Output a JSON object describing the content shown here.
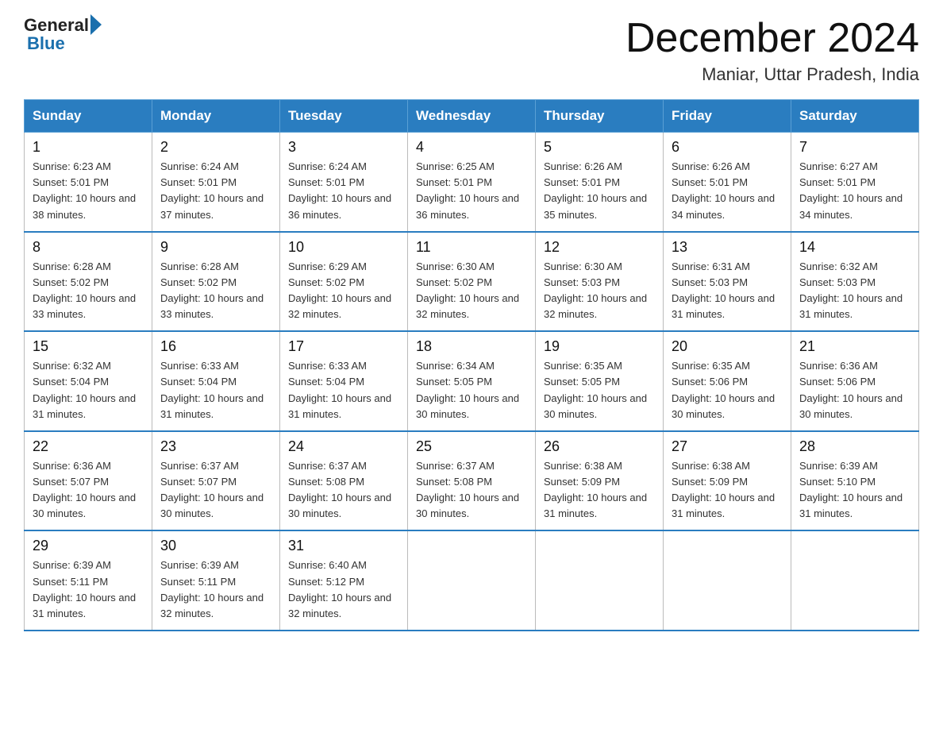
{
  "logo": {
    "text_general": "General",
    "text_blue": "Blue"
  },
  "title": "December 2024",
  "subtitle": "Maniar, Uttar Pradesh, India",
  "days_of_week": [
    "Sunday",
    "Monday",
    "Tuesday",
    "Wednesday",
    "Thursday",
    "Friday",
    "Saturday"
  ],
  "weeks": [
    [
      {
        "day": "1",
        "sunrise": "6:23 AM",
        "sunset": "5:01 PM",
        "daylight": "10 hours and 38 minutes."
      },
      {
        "day": "2",
        "sunrise": "6:24 AM",
        "sunset": "5:01 PM",
        "daylight": "10 hours and 37 minutes."
      },
      {
        "day": "3",
        "sunrise": "6:24 AM",
        "sunset": "5:01 PM",
        "daylight": "10 hours and 36 minutes."
      },
      {
        "day": "4",
        "sunrise": "6:25 AM",
        "sunset": "5:01 PM",
        "daylight": "10 hours and 36 minutes."
      },
      {
        "day": "5",
        "sunrise": "6:26 AM",
        "sunset": "5:01 PM",
        "daylight": "10 hours and 35 minutes."
      },
      {
        "day": "6",
        "sunrise": "6:26 AM",
        "sunset": "5:01 PM",
        "daylight": "10 hours and 34 minutes."
      },
      {
        "day": "7",
        "sunrise": "6:27 AM",
        "sunset": "5:01 PM",
        "daylight": "10 hours and 34 minutes."
      }
    ],
    [
      {
        "day": "8",
        "sunrise": "6:28 AM",
        "sunset": "5:02 PM",
        "daylight": "10 hours and 33 minutes."
      },
      {
        "day": "9",
        "sunrise": "6:28 AM",
        "sunset": "5:02 PM",
        "daylight": "10 hours and 33 minutes."
      },
      {
        "day": "10",
        "sunrise": "6:29 AM",
        "sunset": "5:02 PM",
        "daylight": "10 hours and 32 minutes."
      },
      {
        "day": "11",
        "sunrise": "6:30 AM",
        "sunset": "5:02 PM",
        "daylight": "10 hours and 32 minutes."
      },
      {
        "day": "12",
        "sunrise": "6:30 AM",
        "sunset": "5:03 PM",
        "daylight": "10 hours and 32 minutes."
      },
      {
        "day": "13",
        "sunrise": "6:31 AM",
        "sunset": "5:03 PM",
        "daylight": "10 hours and 31 minutes."
      },
      {
        "day": "14",
        "sunrise": "6:32 AM",
        "sunset": "5:03 PM",
        "daylight": "10 hours and 31 minutes."
      }
    ],
    [
      {
        "day": "15",
        "sunrise": "6:32 AM",
        "sunset": "5:04 PM",
        "daylight": "10 hours and 31 minutes."
      },
      {
        "day": "16",
        "sunrise": "6:33 AM",
        "sunset": "5:04 PM",
        "daylight": "10 hours and 31 minutes."
      },
      {
        "day": "17",
        "sunrise": "6:33 AM",
        "sunset": "5:04 PM",
        "daylight": "10 hours and 31 minutes."
      },
      {
        "day": "18",
        "sunrise": "6:34 AM",
        "sunset": "5:05 PM",
        "daylight": "10 hours and 30 minutes."
      },
      {
        "day": "19",
        "sunrise": "6:35 AM",
        "sunset": "5:05 PM",
        "daylight": "10 hours and 30 minutes."
      },
      {
        "day": "20",
        "sunrise": "6:35 AM",
        "sunset": "5:06 PM",
        "daylight": "10 hours and 30 minutes."
      },
      {
        "day": "21",
        "sunrise": "6:36 AM",
        "sunset": "5:06 PM",
        "daylight": "10 hours and 30 minutes."
      }
    ],
    [
      {
        "day": "22",
        "sunrise": "6:36 AM",
        "sunset": "5:07 PM",
        "daylight": "10 hours and 30 minutes."
      },
      {
        "day": "23",
        "sunrise": "6:37 AM",
        "sunset": "5:07 PM",
        "daylight": "10 hours and 30 minutes."
      },
      {
        "day": "24",
        "sunrise": "6:37 AM",
        "sunset": "5:08 PM",
        "daylight": "10 hours and 30 minutes."
      },
      {
        "day": "25",
        "sunrise": "6:37 AM",
        "sunset": "5:08 PM",
        "daylight": "10 hours and 30 minutes."
      },
      {
        "day": "26",
        "sunrise": "6:38 AM",
        "sunset": "5:09 PM",
        "daylight": "10 hours and 31 minutes."
      },
      {
        "day": "27",
        "sunrise": "6:38 AM",
        "sunset": "5:09 PM",
        "daylight": "10 hours and 31 minutes."
      },
      {
        "day": "28",
        "sunrise": "6:39 AM",
        "sunset": "5:10 PM",
        "daylight": "10 hours and 31 minutes."
      }
    ],
    [
      {
        "day": "29",
        "sunrise": "6:39 AM",
        "sunset": "5:11 PM",
        "daylight": "10 hours and 31 minutes."
      },
      {
        "day": "30",
        "sunrise": "6:39 AM",
        "sunset": "5:11 PM",
        "daylight": "10 hours and 32 minutes."
      },
      {
        "day": "31",
        "sunrise": "6:40 AM",
        "sunset": "5:12 PM",
        "daylight": "10 hours and 32 minutes."
      },
      null,
      null,
      null,
      null
    ]
  ]
}
